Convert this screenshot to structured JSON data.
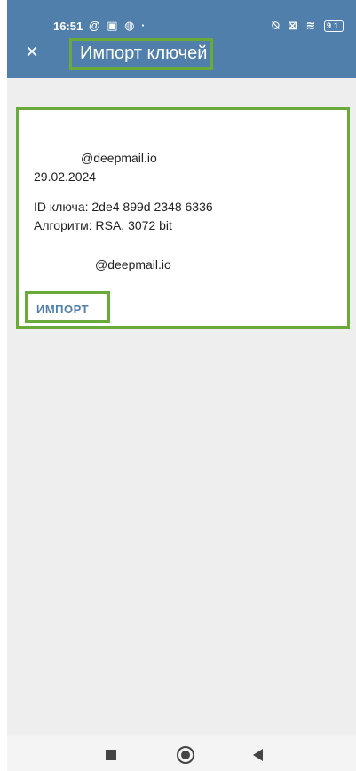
{
  "status_bar": {
    "time": "16:51",
    "left_icons": "@ ▣ ◍ ·",
    "right_icons": "⍉ ⊠ ≋",
    "battery": "91"
  },
  "app_bar": {
    "close_icon": "×",
    "title": "Импорт ключей"
  },
  "key_card": {
    "email": "@deepmail.io",
    "date": "29.02.2024",
    "key_id": "ID ключа:  2de4 899d 2348 6336",
    "algorithm": "Алгоритм:  RSA, 3072 bit",
    "user_email": "@deepmail.io",
    "import_label": "ИМПОРТ"
  },
  "colors": {
    "app_bar": "#4f7faa",
    "highlight": "#6aaa3a",
    "background": "#eeeeee"
  }
}
